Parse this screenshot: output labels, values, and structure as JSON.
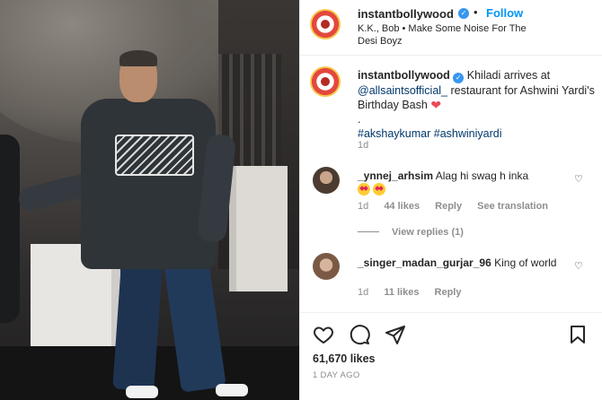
{
  "post": {
    "username": "instantbollywood",
    "follow_label": "Follow",
    "audio": "K.K., Bob • Make Some Noise For The Desi Boyz"
  },
  "caption": {
    "username": "instantbollywood",
    "text_before": "Khiladi arrives at",
    "mention": "@allsaintsofficial_",
    "text_after": "restaurant for Ashwini Yardi's Birthday Bash",
    "dot": ".",
    "tags": "#akshaykumar #ashwiniyardi",
    "age": "1d"
  },
  "comments": [
    {
      "username": "_ynnej_arhsim",
      "text": "Alag hi swag h inka",
      "age": "1d",
      "likes": "44 likes",
      "reply_label": "Reply",
      "translation_label": "See translation"
    },
    {
      "username": "_singer_madan_gurjar_96",
      "text": "King of world",
      "age": "1d",
      "likes": "11 likes",
      "reply_label": "Reply"
    }
  ],
  "view_replies": "View replies (1)",
  "footer": {
    "likes": "61,670 likes",
    "time": "1 DAY AGO"
  },
  "colors": {
    "follow": "#0095f6",
    "link": "#00376b",
    "heart": "#ed4956"
  },
  "icons": [
    "heart-icon",
    "comment-icon",
    "share-icon",
    "save-icon",
    "verified-icon",
    "more-icon"
  ]
}
